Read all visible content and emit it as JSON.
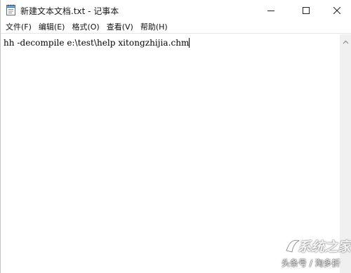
{
  "window": {
    "title": "新建文本文档.txt - 记事本",
    "icons": {
      "app": "notepad-icon",
      "minimize": "minimize-icon",
      "maximize": "maximize-icon",
      "close": "close-icon",
      "scroll_up": "scroll-up-arrow-icon"
    }
  },
  "menubar": {
    "items": [
      {
        "label": "文件(F)"
      },
      {
        "label": "编辑(E)"
      },
      {
        "label": "格式(O)"
      },
      {
        "label": "查看(V)"
      },
      {
        "label": "帮助(H)"
      }
    ]
  },
  "editor": {
    "content": "hh -decompile e:\\test\\help xitongzhijia.chm"
  },
  "watermark": {
    "logo_text": "系统之家",
    "caption": "头条号 / 淘多折"
  },
  "colors": {
    "background": "#ffffff",
    "menubar_border": "#e6e6e6",
    "scrollbar": "#f0f0f0"
  }
}
